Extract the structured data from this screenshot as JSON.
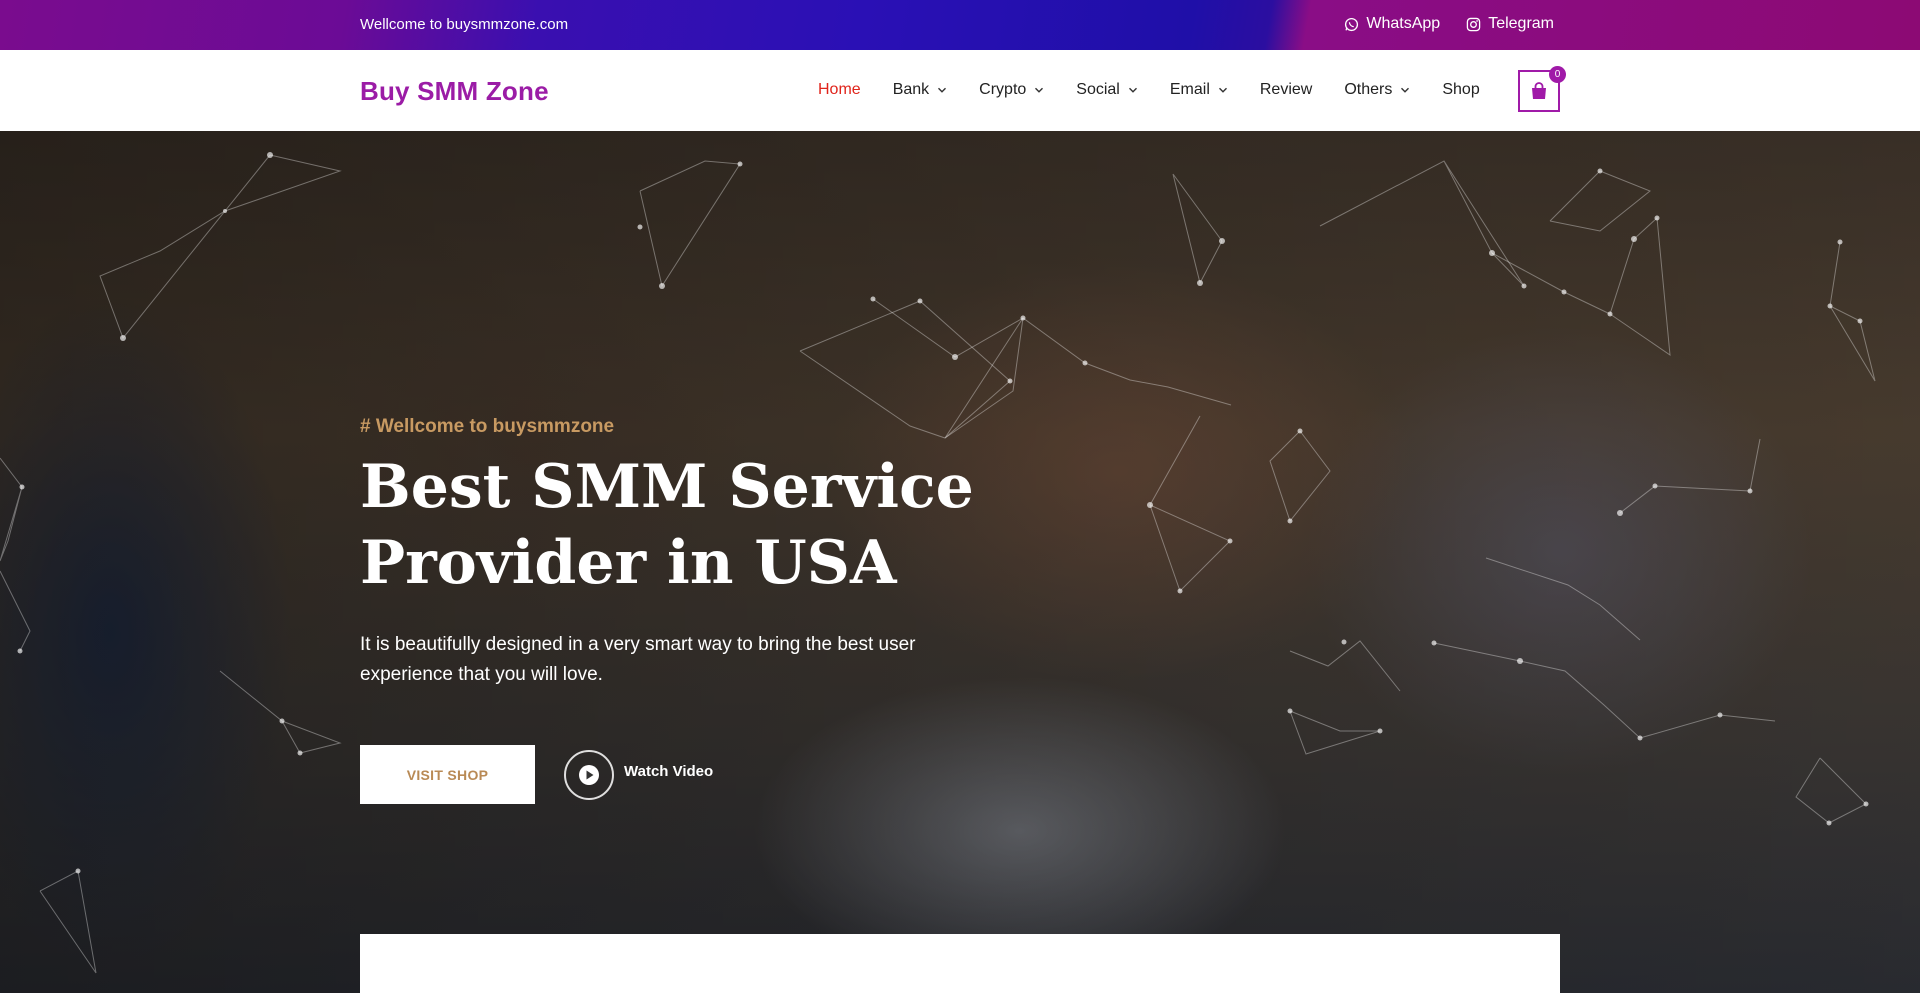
{
  "topbar": {
    "welcome": "Wellcome to buysmmzone.com",
    "whatsapp_label": "WhatsApp",
    "telegram_label": "Telegram"
  },
  "header": {
    "logo": "Buy SMM Zone",
    "nav": [
      {
        "label": "Home",
        "active": true,
        "dropdown": false
      },
      {
        "label": "Bank",
        "active": false,
        "dropdown": true
      },
      {
        "label": "Crypto",
        "active": false,
        "dropdown": true
      },
      {
        "label": "Social",
        "active": false,
        "dropdown": true
      },
      {
        "label": "Email",
        "active": false,
        "dropdown": true
      },
      {
        "label": "Review",
        "active": false,
        "dropdown": false
      },
      {
        "label": "Others",
        "active": false,
        "dropdown": true
      },
      {
        "label": "Shop",
        "active": false,
        "dropdown": false
      }
    ],
    "cart_count": "0"
  },
  "hero": {
    "tagline": "# Wellcome to buysmmzone",
    "title": "Best SMM Service Provider in USA",
    "description": "It is beautifully designed in a very smart way to bring the best user experience that you will love.",
    "shop_button": "VISIT SHOP",
    "video_label": "Watch Video"
  },
  "colors": {
    "brand": "#9b1ca6",
    "active_nav": "#e0241b",
    "accent_gold": "#c89a62"
  },
  "icons": {
    "whatsapp": "whatsapp-icon",
    "telegram": "instagram-style-icon",
    "cart": "shopping-bag-icon",
    "play": "play-icon",
    "chevron": "chevron-down-icon"
  }
}
